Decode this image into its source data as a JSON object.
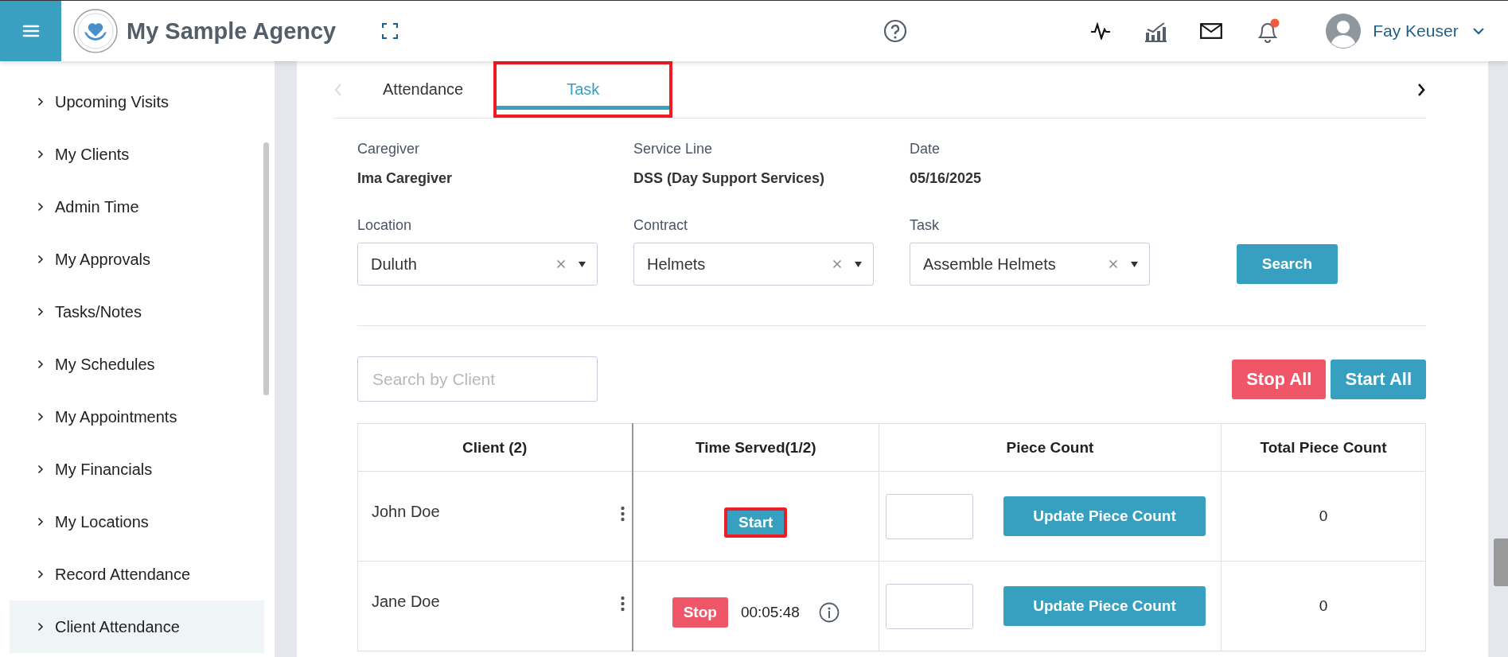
{
  "header": {
    "agency_name": "My Sample Agency",
    "user_name": "Fay Keuser",
    "bell_unread": true
  },
  "sidebar": {
    "items": [
      {
        "label": "Upcoming Visits",
        "selected": false
      },
      {
        "label": "My Clients",
        "selected": false
      },
      {
        "label": "Admin Time",
        "selected": false
      },
      {
        "label": "My Approvals",
        "selected": false
      },
      {
        "label": "Tasks/Notes",
        "selected": false
      },
      {
        "label": "My Schedules",
        "selected": false
      },
      {
        "label": "My Appointments",
        "selected": false
      },
      {
        "label": "My Financials",
        "selected": false
      },
      {
        "label": "My Locations",
        "selected": false
      },
      {
        "label": "Record Attendance",
        "selected": false
      },
      {
        "label": "Client Attendance",
        "selected": true
      }
    ]
  },
  "tabs": [
    {
      "label": "Attendance",
      "selected": false,
      "highlighted": false
    },
    {
      "label": "Task",
      "selected": true,
      "highlighted": true
    }
  ],
  "info": [
    {
      "label": "Caregiver",
      "value": "Ima Caregiver"
    },
    {
      "label": "Service Line",
      "value": "DSS (Day Support Services)"
    },
    {
      "label": "Date",
      "value": "05/16/2025"
    }
  ],
  "filters": [
    {
      "label": "Location",
      "value": "Duluth"
    },
    {
      "label": "Contract",
      "value": "Helmets"
    },
    {
      "label": "Task",
      "value": "Assemble Helmets"
    }
  ],
  "search_button": "Search",
  "client_search": {
    "placeholder": "Search by Client"
  },
  "stop_all": "Stop All",
  "start_all": "Start All",
  "table": {
    "columns": [
      "Client (2)",
      "Time Served(1/2)",
      "Piece Count",
      "Total Piece Count"
    ],
    "rows": [
      {
        "client": "John Doe",
        "kind": "idle",
        "button": "Start",
        "highlighted": true,
        "update": "Update Piece Count",
        "total": "0"
      },
      {
        "client": "Jane Doe",
        "kind": "running",
        "button": "Stop",
        "elapsed": "00:05:48",
        "update": "Update Piece Count",
        "total": "0"
      }
    ]
  }
}
